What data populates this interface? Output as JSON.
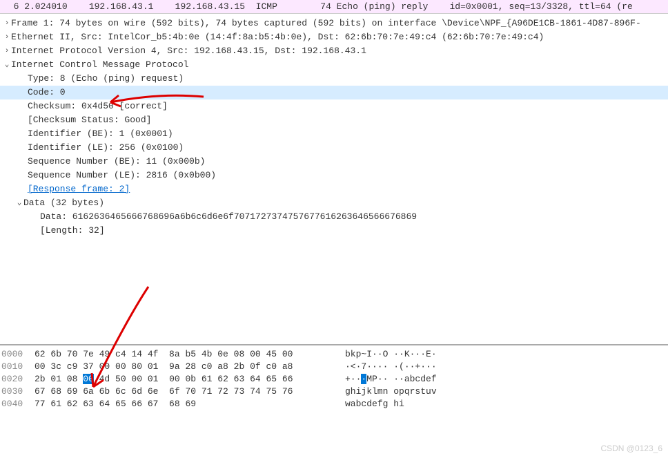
{
  "packet_list": {
    "row": "  6 2.024010    192.168.43.1    192.168.43.15  ICMP        74 Echo (ping) reply    id=0x0001, seq=13/3328, ttl=64 (re"
  },
  "details": {
    "frame": "Frame 1: 74 bytes on wire (592 bits), 74 bytes captured (592 bits) on interface \\Device\\NPF_{A96DE1CB-1861-4D87-896F-",
    "eth": "Ethernet II, Src: IntelCor_b5:4b:0e (14:4f:8a:b5:4b:0e), Dst: 62:6b:70:7e:49:c4 (62:6b:70:7e:49:c4)",
    "ip": "Internet Protocol Version 4, Src: 192.168.43.15, Dst: 192.168.43.1",
    "icmp": {
      "title": "Internet Control Message Protocol",
      "type": "Type: 8 (Echo (ping) request)",
      "code": "Code: 0",
      "checksum": "Checksum: 0x4d50 [correct]",
      "checksum_status": "[Checksum Status: Good]",
      "id_be": "Identifier (BE): 1 (0x0001)",
      "id_le": "Identifier (LE): 256 (0x0100)",
      "seq_be": "Sequence Number (BE): 11 (0x000b)",
      "seq_le": "Sequence Number (LE): 2816 (0x0b00)",
      "resp_frame": "[Response frame: 2]",
      "data_title": "Data (32 bytes)",
      "data_hex": "Data: 6162636465666768696a6b6c6d6e6f7071727374757677616263646566676869",
      "data_len": "[Length: 32]"
    }
  },
  "hex": {
    "rows": [
      {
        "off": "0000",
        "b1": "62 6b 70 7e 49 c4 14 4f",
        "b2": "8a b5 4b 0e 08 00 45 00",
        "a": "bkp~I··O ··K···E·"
      },
      {
        "off": "0010",
        "b1": "00 3c c9 37 00 00 80 01",
        "b2": "9a 28 c0 a8 2b 0f c0 a8",
        "a": "·<·7···· ·(··+···"
      },
      {
        "off": "0020",
        "b1a": "2b 01 08 ",
        "sel": "00",
        "b1b": " 4d 50 00 01",
        "b2": "00 0b 61 62 63 64 65 66",
        "a1": "+··",
        "asel": "·",
        "a2": "MP·· ··abcdef"
      },
      {
        "off": "0030",
        "b1": "67 68 69 6a 6b 6c 6d 6e",
        "b2": "6f 70 71 72 73 74 75 76",
        "a": "ghijklmn opqrstuv"
      },
      {
        "off": "0040",
        "b1": "77 61 62 63 64 65 66 67",
        "b2": "68 69",
        "a": "wabcdefg hi"
      }
    ]
  },
  "watermark": "CSDN @0123_6"
}
